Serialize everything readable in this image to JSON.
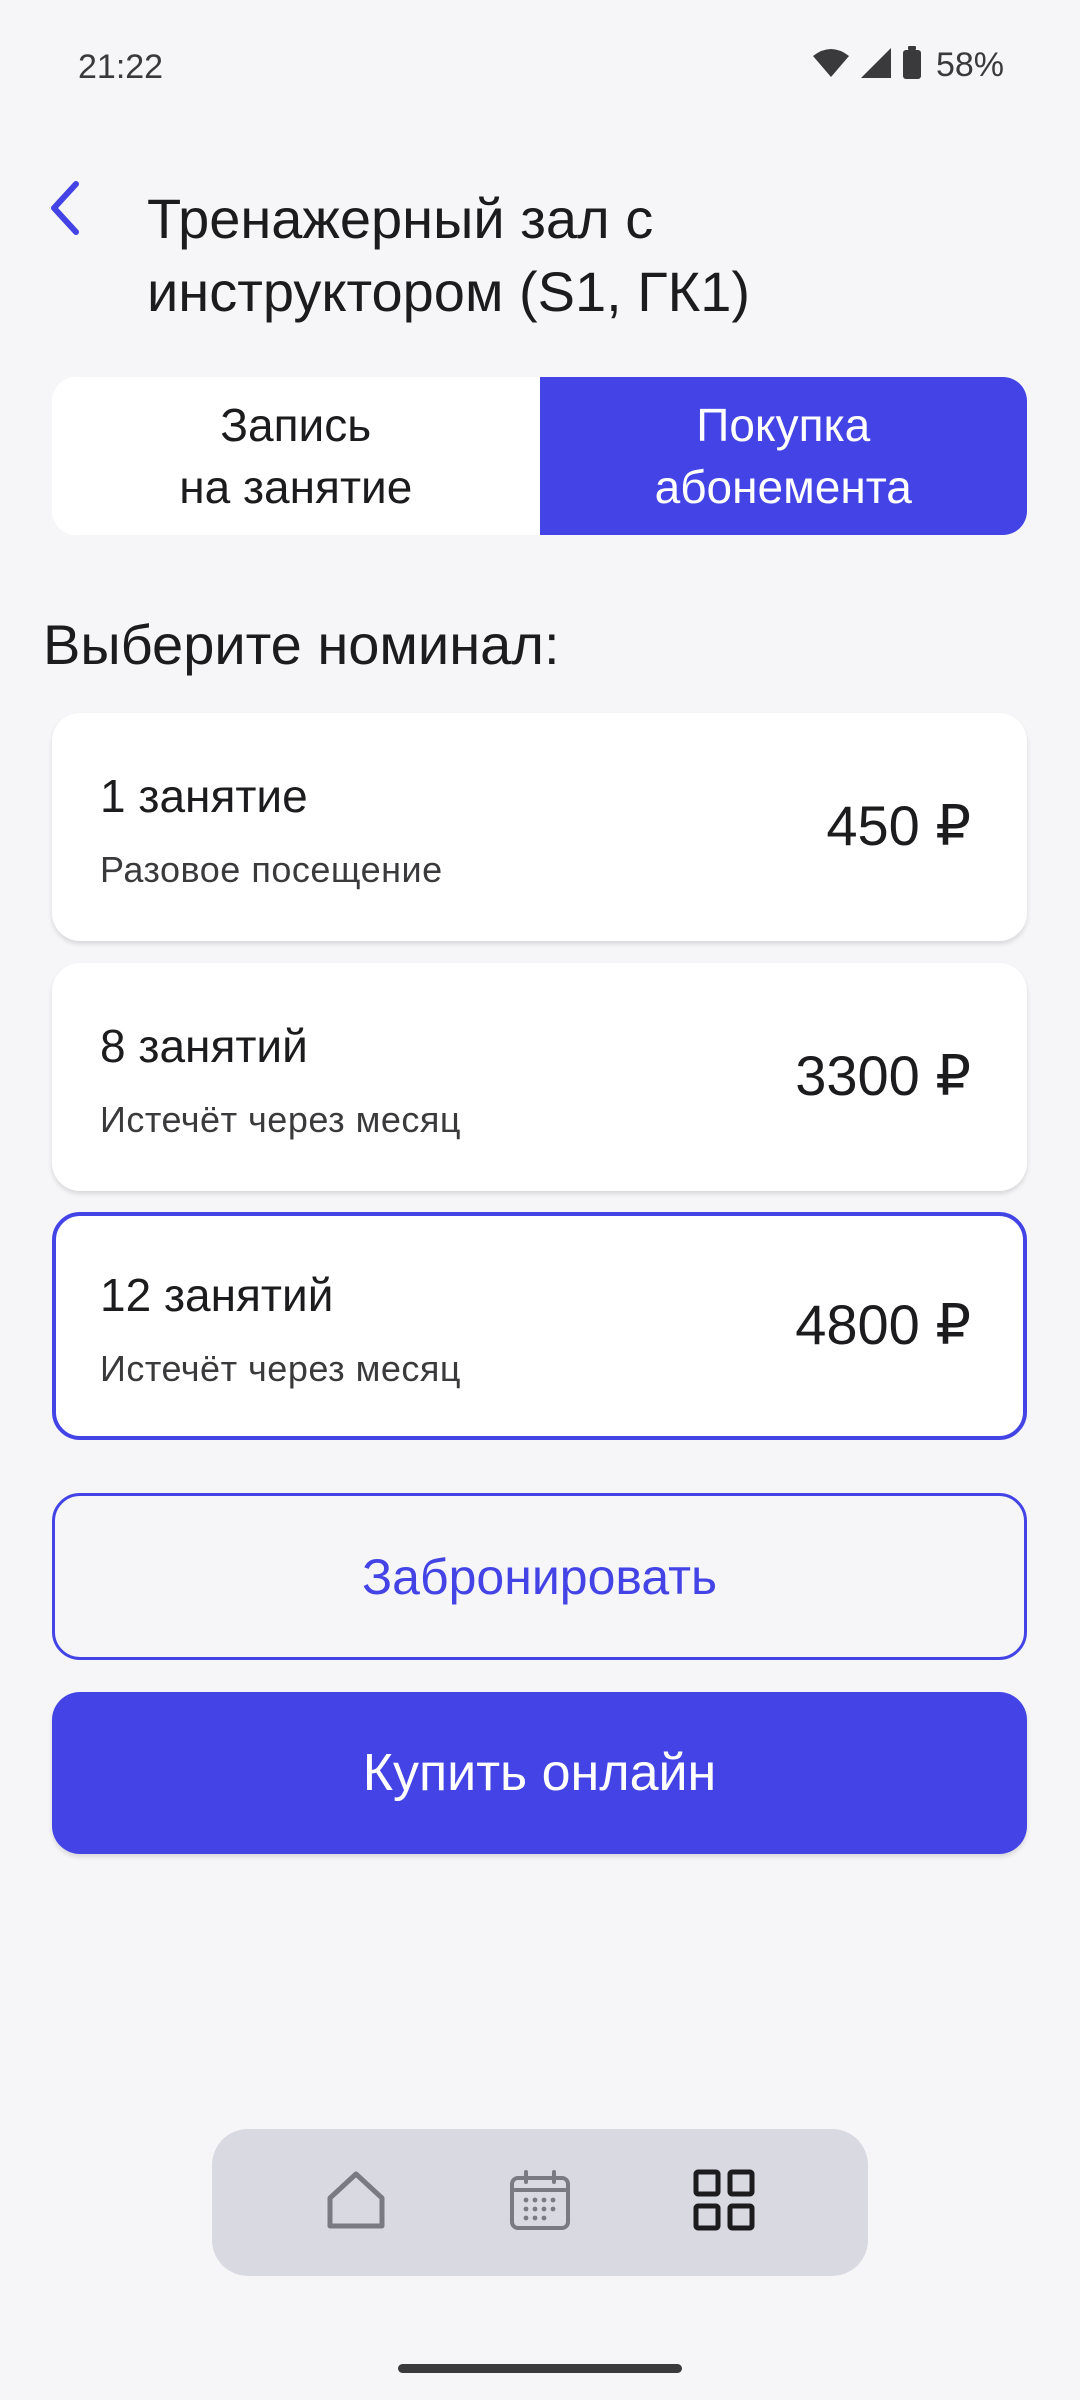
{
  "status_bar": {
    "time": "21:22",
    "battery": "58%"
  },
  "header": {
    "title": "Тренажерный зал с инструктором (S1, ГК1)"
  },
  "tabs": [
    {
      "label": "Запись\nна занятие",
      "active": false
    },
    {
      "label": "Покупка\nабонемента",
      "active": true
    }
  ],
  "section_title": "Выберите номинал:",
  "plans": [
    {
      "name": "1 занятие",
      "desc": "Разовое посещение",
      "price": "450 ₽",
      "selected": false
    },
    {
      "name": "8 занятий",
      "desc": "Истечёт через месяц",
      "price": "3300 ₽",
      "selected": false
    },
    {
      "name": "12 занятий",
      "desc": "Истечёт через месяц",
      "price": "4800 ₽",
      "selected": true
    }
  ],
  "buttons": {
    "book": "Забронировать",
    "buy": "Купить онлайн"
  },
  "bottom_nav": [
    "home-icon",
    "calendar-icon",
    "grid-icon"
  ],
  "colors": {
    "accent": "#4444e6",
    "background": "#f6f6f8",
    "nav_background": "#d9d9e2"
  }
}
